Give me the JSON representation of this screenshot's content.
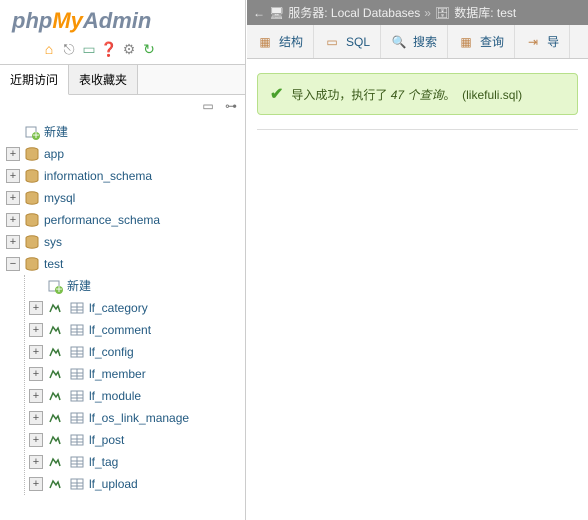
{
  "logo": {
    "p1": "php",
    "p2": "My",
    "p3": "Admin"
  },
  "quick": [
    {
      "name": "home-icon",
      "glyph": "⌂",
      "color": "#f89405"
    },
    {
      "name": "logout-icon",
      "glyph": "⎋",
      "color": "#888"
    },
    {
      "name": "sql-icon",
      "glyph": "▭",
      "color": "#6a8"
    },
    {
      "name": "docs-icon",
      "glyph": "❓",
      "color": "#6a8"
    },
    {
      "name": "settings-icon",
      "glyph": "⚙",
      "color": "#888"
    },
    {
      "name": "refresh-icon",
      "glyph": "↻",
      "color": "#4a4"
    }
  ],
  "sidetabs": {
    "recent": "近期访问",
    "fav": "表收藏夹"
  },
  "treeNew": "新建",
  "dbs": [
    {
      "name": "app"
    },
    {
      "name": "information_schema"
    },
    {
      "name": "mysql"
    },
    {
      "name": "performance_schema"
    },
    {
      "name": "sys"
    },
    {
      "name": "test",
      "open": true,
      "newLabel": "新建",
      "tables": [
        "lf_category",
        "lf_comment",
        "lf_config",
        "lf_member",
        "lf_module",
        "lf_os_link_manage",
        "lf_post",
        "lf_tag",
        "lf_upload"
      ]
    }
  ],
  "crumb": {
    "back": "←",
    "server_label": "服务器: Local Databases",
    "sep": "»",
    "db_label": "数据库: test"
  },
  "toolbar": [
    {
      "id": "structure",
      "label": "结构",
      "icon": "structure-icon"
    },
    {
      "id": "sql",
      "label": "SQL",
      "icon": "sql-icon"
    },
    {
      "id": "search",
      "label": "搜索",
      "icon": "search-icon"
    },
    {
      "id": "query",
      "label": "查询",
      "icon": "query-icon"
    },
    {
      "id": "export",
      "label": "导",
      "icon": "export-icon"
    }
  ],
  "message": {
    "pre": "导入成功，执行了 ",
    "count": "47 个查询",
    "post": "。",
    "file": "(likefuli.sql)"
  }
}
